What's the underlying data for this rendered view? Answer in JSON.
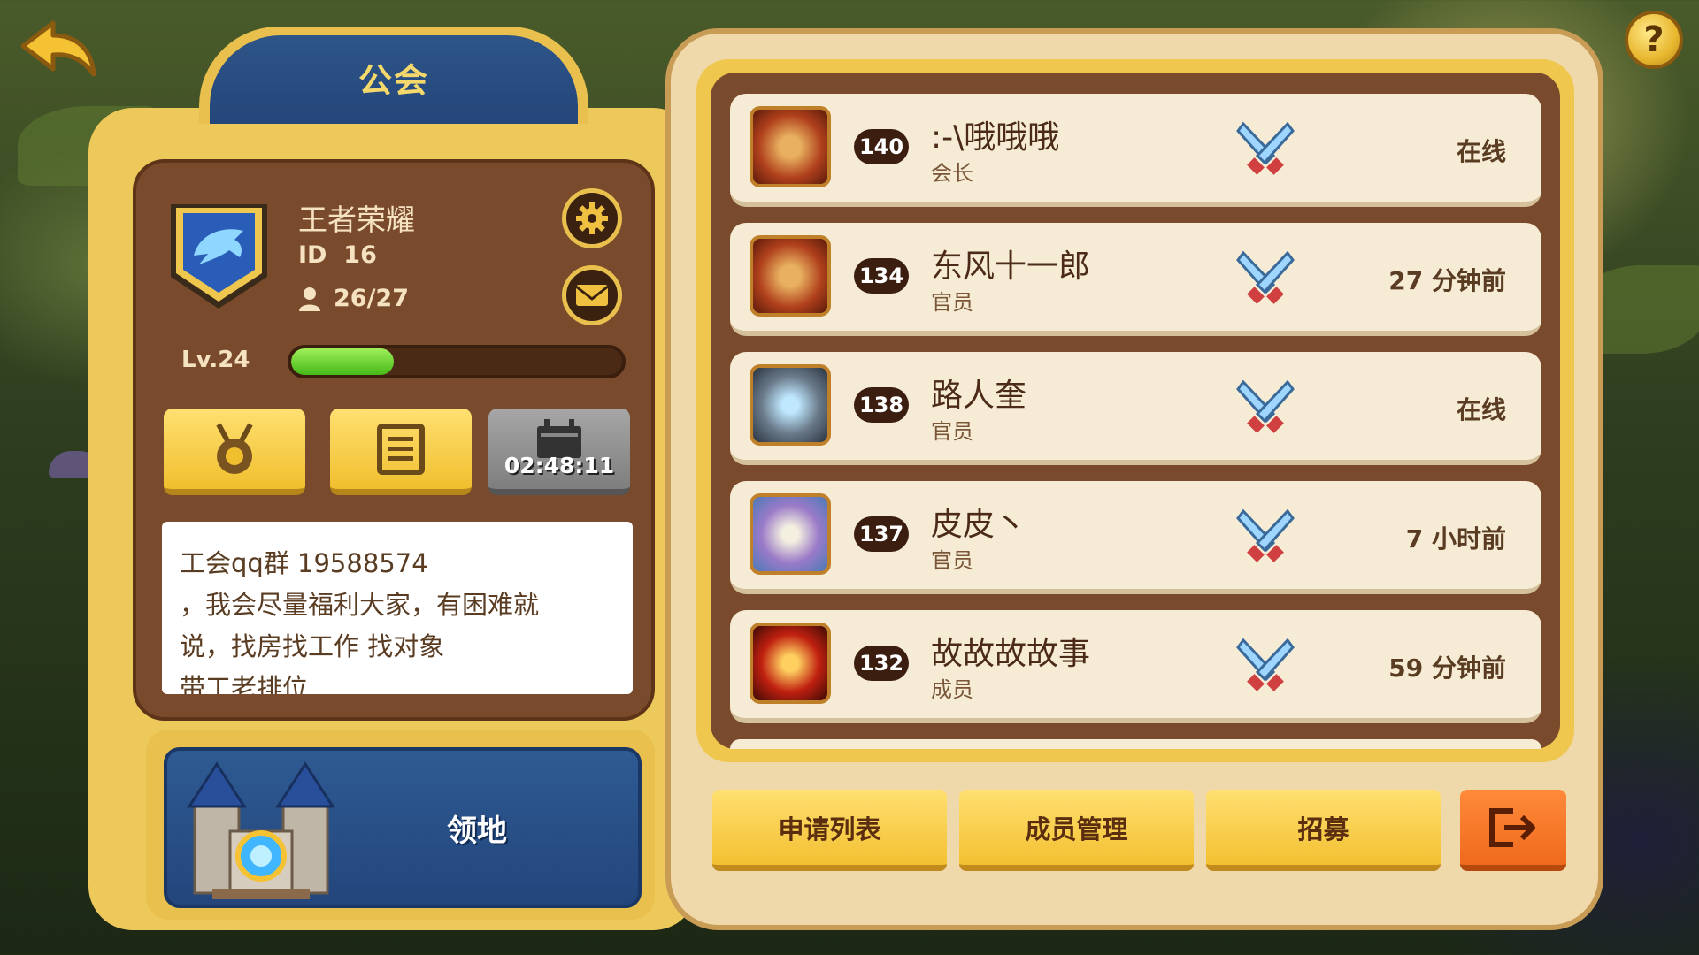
{
  "header": {
    "title": "公会"
  },
  "guild": {
    "name": "王者荣耀",
    "id_label": "ID",
    "id_value": "16",
    "members": "26/27",
    "level": "Lv.24",
    "xp_fraction": 0.31,
    "timer": "02:48:11",
    "notice_lines": [
      "工会qq群 19588574",
      "，我会尽量福利大家，有困难就",
      "说，找房找工作 找对象",
      "带工老排位"
    ]
  },
  "territory": {
    "label": "领地"
  },
  "members": [
    {
      "level": "140",
      "name": ":-\\哦哦哦",
      "role": "会长",
      "status": "在线",
      "avatar": "knight-red-avatar"
    },
    {
      "level": "134",
      "name": "东风十一郎",
      "role": "官员",
      "status": "27 分钟前",
      "avatar": "knight-red-avatar"
    },
    {
      "level": "138",
      "name": "路人奎",
      "role": "官员",
      "status": "在线",
      "avatar": "skeleton-avatar"
    },
    {
      "level": "137",
      "name": "皮皮丶",
      "role": "官员",
      "status": "7 小时前",
      "avatar": "wizard-avatar"
    },
    {
      "level": "132",
      "name": "故故故故事",
      "role": "成员",
      "status": "59 分钟前",
      "avatar": "demon-avatar"
    }
  ],
  "actions": {
    "apply_list": "申请列表",
    "member_manage": "成员管理",
    "recruit": "招募"
  },
  "colors": {
    "gold": "#edc85a",
    "brown": "#7a4a2c",
    "navy": "#2e5588",
    "orange": "#ef6a1c",
    "xp_green": "#47b818"
  }
}
